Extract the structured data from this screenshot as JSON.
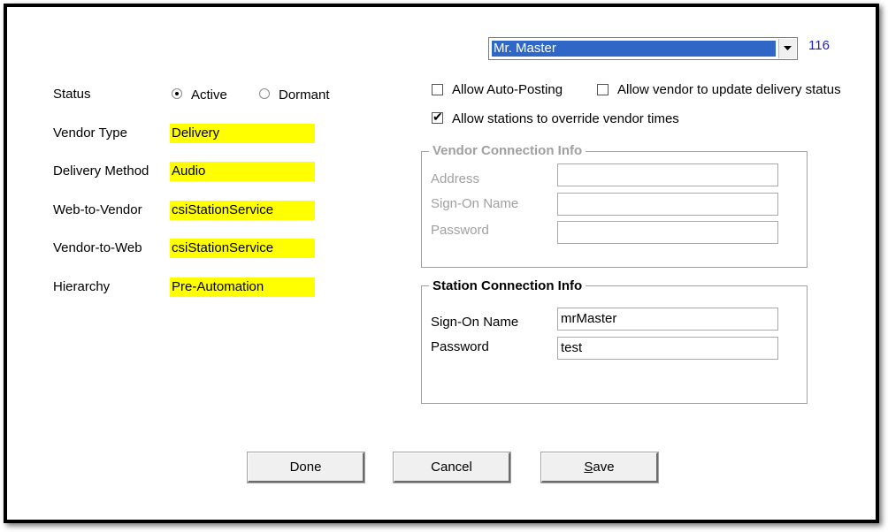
{
  "header": {
    "combo_value": "Mr. Master",
    "record_id": "116",
    "record_id_color": "#1a1adc"
  },
  "status": {
    "label": "Status",
    "options": [
      "Active",
      "Dormant"
    ],
    "selected": "Active"
  },
  "fields": {
    "vendor_type_label": "Vendor Type",
    "vendor_type_value": "Delivery",
    "delivery_method_label": "Delivery Method",
    "delivery_method_value": "Audio",
    "web_to_vendor_label": "Web-to-Vendor",
    "web_to_vendor_value": "csiStationService",
    "vendor_to_web_label": "Vendor-to-Web",
    "vendor_to_web_value": "csiStationService",
    "hierarchy_label": "Hierarchy",
    "hierarchy_value": "Pre-Automation",
    "highlight_color": "#ffff00"
  },
  "options": {
    "auto_posting_label": "Allow Auto-Posting",
    "auto_posting_checked": false,
    "vendor_update_label": "Allow vendor to update delivery status",
    "vendor_update_checked": false,
    "override_label": "Allow stations to override vendor times",
    "override_checked": true
  },
  "vendor_connection": {
    "title": "Vendor Connection Info",
    "address_label": "Address",
    "address_value": "",
    "signon_label": "Sign-On Name",
    "signon_value": "",
    "password_label": "Password",
    "password_value": ""
  },
  "station_connection": {
    "title": "Station Connection Info",
    "signon_label": "Sign-On Name",
    "signon_value": "mrMaster",
    "password_label": "Password",
    "password_value": "test"
  },
  "buttons": {
    "done": "Done",
    "cancel": "Cancel",
    "save_underlined": "S",
    "save_rest": "ave"
  }
}
